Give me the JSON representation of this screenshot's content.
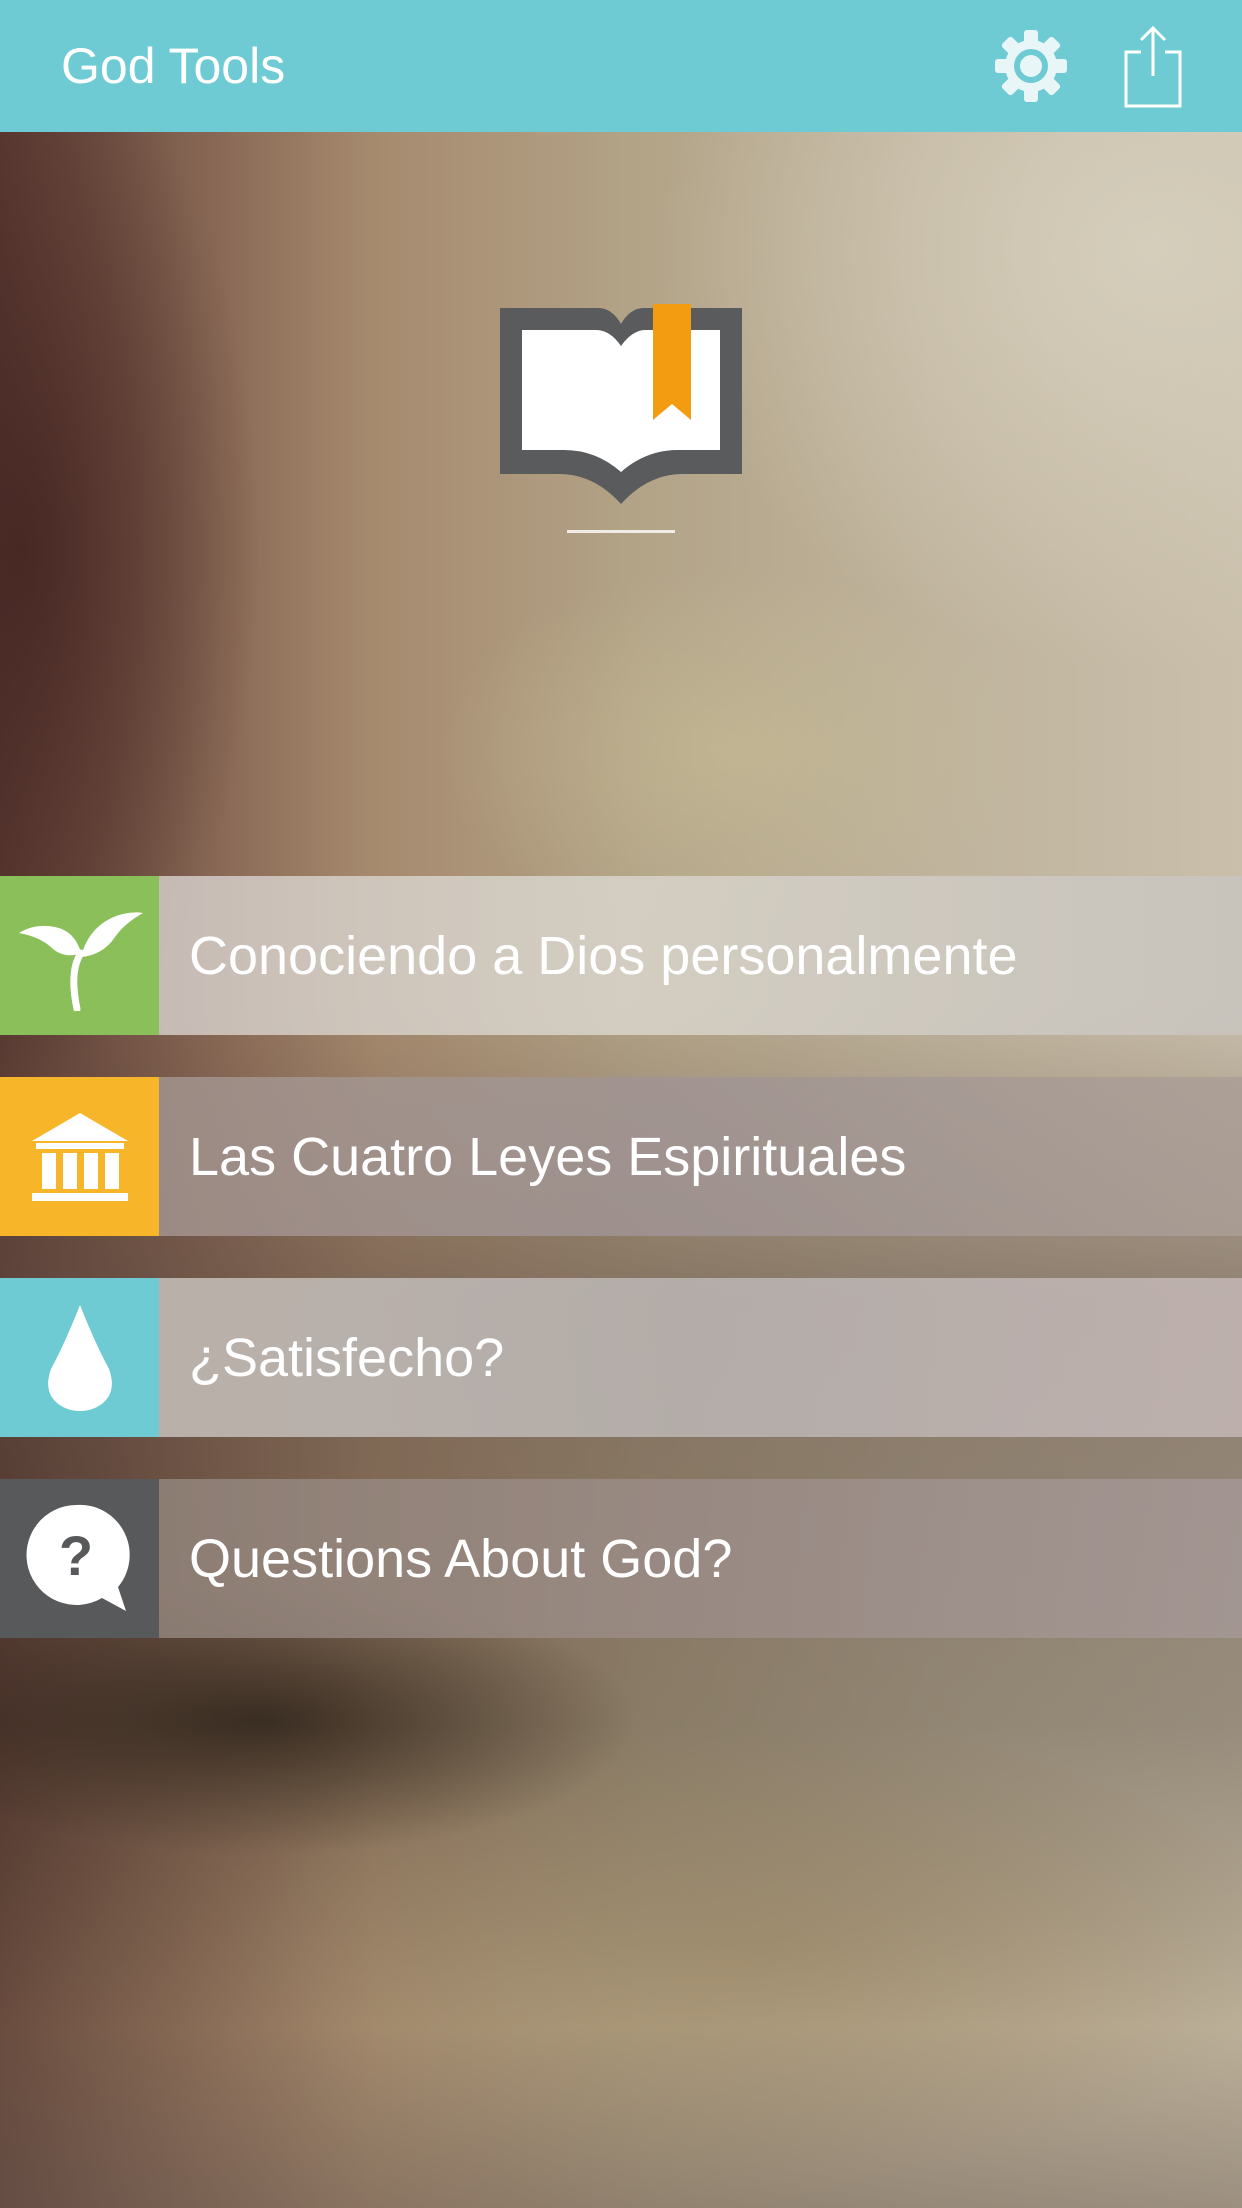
{
  "header": {
    "title": "God Tools",
    "settings_icon": "gear-icon",
    "share_icon": "share-icon",
    "background_color": "#6ecbd4"
  },
  "hero": {
    "logo_icon": "open-book-bookmark-icon",
    "logo_colors": {
      "book_frame": "#5a5b5d",
      "bookmark": "#f39c12",
      "pages": "#ffffff"
    }
  },
  "menu": {
    "items": [
      {
        "label": "Conociendo a Dios personalmente",
        "icon": "sprout-icon",
        "color": "#8bbf5a"
      },
      {
        "label": "Las Cuatro Leyes Espirituales",
        "icon": "temple-icon",
        "color": "#f7b529"
      },
      {
        "label": "¿Satisfecho?",
        "icon": "water-drop-icon",
        "color": "#6ecbd4"
      },
      {
        "label": "Questions About God?",
        "icon": "question-bubble-icon",
        "color": "#58595b"
      }
    ]
  }
}
